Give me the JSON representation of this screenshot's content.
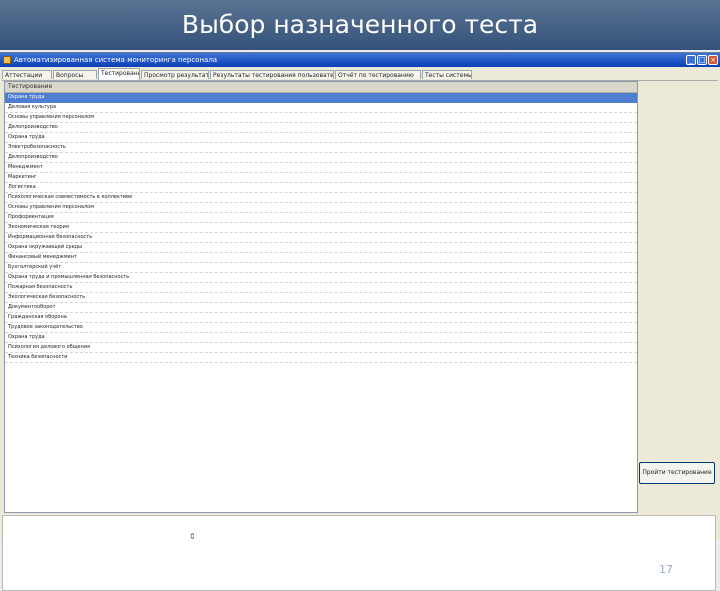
{
  "slide": {
    "title": "Выбор назначенного теста",
    "page_number": "17"
  },
  "window": {
    "title": "Автоматизированная система мониторинга персонала",
    "controls": {
      "minimize": "_",
      "maximize": "□",
      "close": "×"
    }
  },
  "tabs": [
    {
      "label": "Аттестации"
    },
    {
      "label": "Вопросы"
    },
    {
      "label": "Тестирование",
      "active": true
    },
    {
      "label": "Просмотр результатов"
    },
    {
      "label": "Результаты тестирования пользователей"
    },
    {
      "label": "Отчёт по тестированию"
    },
    {
      "label": "Тесты системы"
    }
  ],
  "list": {
    "header": "Тестирование",
    "items": [
      "Охрана труда",
      "Деловая культура",
      "Основы управления персоналом",
      "Делопроизводство",
      "Охрана труда",
      "Электробезопасность",
      "Делопроизводство",
      "Менеджмент",
      "Маркетинг",
      "Логистика",
      "Психологическая совместимость в коллективе",
      "Основы управления персоналом",
      "Профориентация",
      "Экономическая теория",
      "Информационная безопасность",
      "Охрана окружающей среды",
      "Финансовый менеджмент",
      "Бухгалтерский учёт",
      "Охрана труда и промышленная безопасность",
      "Пожарная безопасность",
      "Экологическая безопасность",
      "Документооборот",
      "Гражданская оборона",
      "Трудовое законодательство",
      "Охрана труда",
      "Психология делового общения",
      "Техника безопасности"
    ]
  },
  "buttons": {
    "start_test": "Пройти тестирование"
  },
  "icons": {
    "app": "app-icon",
    "arrow": "⇕"
  },
  "colors": {
    "header_bg": "#34527a",
    "selection": "#4f7ed0",
    "titlebar": "#0a3fb5"
  }
}
